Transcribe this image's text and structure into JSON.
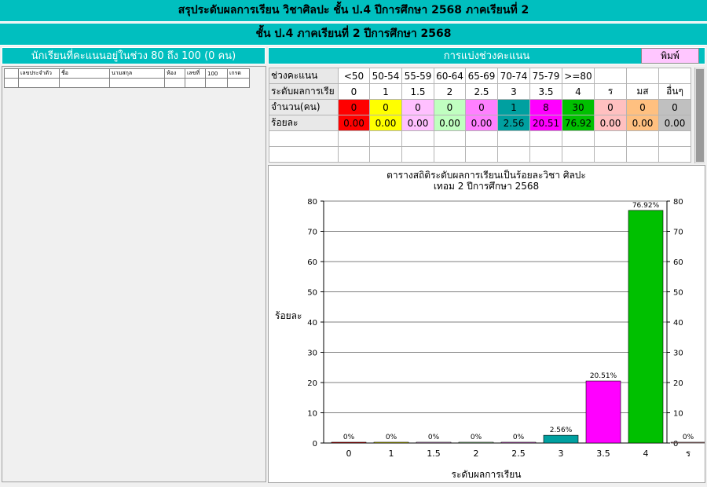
{
  "header": {
    "title": "สรุประดับผลการเรียน วิชาศิลปะ ชั้น ป.4  ปีการศึกษา  2568 ภาคเรียนที่  2",
    "subtitle": "ชั้น ป.4 ภาคเรียนที่  2  ปีการศึกษา  2568"
  },
  "left_panel": {
    "header": "นักเรียนที่คะแนนอยู่ในช่วง 80 ถึง 100 (0 คน)",
    "columns": [
      "",
      "เลขประจำตัว",
      "ชื่อ",
      "นามสกุล",
      "ห้อง",
      "เลขที่",
      "100",
      "เกรด"
    ]
  },
  "right_panel": {
    "header": "การแบ่งช่วงคะแนน",
    "print_label": "พิมพ์"
  },
  "grade_table": {
    "row_labels": [
      "ช่วงคะแนน",
      "ระดับผลการเรีย",
      "จำนวน(คน)",
      "ร้อยละ"
    ],
    "ranges": [
      "<50",
      "50-54",
      "55-59",
      "60-64",
      "65-69",
      "70-74",
      "75-79",
      ">=80",
      "",
      "",
      ""
    ],
    "grades": [
      "0",
      "1",
      "1.5",
      "2",
      "2.5",
      "3",
      "3.5",
      "4",
      "ร",
      "มส",
      "อื่นๆ"
    ],
    "counts": [
      "0",
      "0",
      "0",
      "0",
      "0",
      "1",
      "8",
      "30",
      "0",
      "0",
      "0"
    ],
    "percents": [
      "0.00",
      "0.00",
      "0.00",
      "0.00",
      "0.00",
      "2.56",
      "20.51",
      "76.92",
      "0.00",
      "0.00",
      "0.00"
    ],
    "colors": [
      "#ff0000",
      "#ffff00",
      "#ffc0ff",
      "#c0ffc0",
      "#ff80ff",
      "#00a0a0",
      "#ff00ff",
      "#00c000",
      "#ffc0c0",
      "#ffc080",
      "#c0c0c0"
    ]
  },
  "chart_data": {
    "type": "bar",
    "title": "ตารางสถิติระดับผลการเรียนเป็นร้อยละวิชา ศิลปะ",
    "subtitle": "เทอม 2 ปีการศึกษา 2568",
    "xlabel": "ระดับผลการเรียน",
    "ylabel": "ร้อยละ",
    "categories": [
      "0",
      "1",
      "1.5",
      "2",
      "2.5",
      "3",
      "3.5",
      "4",
      "ร"
    ],
    "values": [
      0,
      0,
      0,
      0,
      0,
      2.56,
      20.51,
      76.92,
      0
    ],
    "value_labels": [
      "0%",
      "0%",
      "0%",
      "0%",
      "0%",
      "2.56%",
      "20.51%",
      "76.92%",
      "0%"
    ],
    "colors": [
      "#ff0000",
      "#ffff00",
      "#ffc0ff",
      "#c0ffc0",
      "#ff80ff",
      "#00a0a0",
      "#ff00ff",
      "#00c000",
      "#ffc0c0"
    ],
    "yticks": [
      0,
      10,
      20,
      30,
      40,
      50,
      60,
      70,
      80
    ],
    "ylim": [
      0,
      80
    ],
    "grid": true
  }
}
